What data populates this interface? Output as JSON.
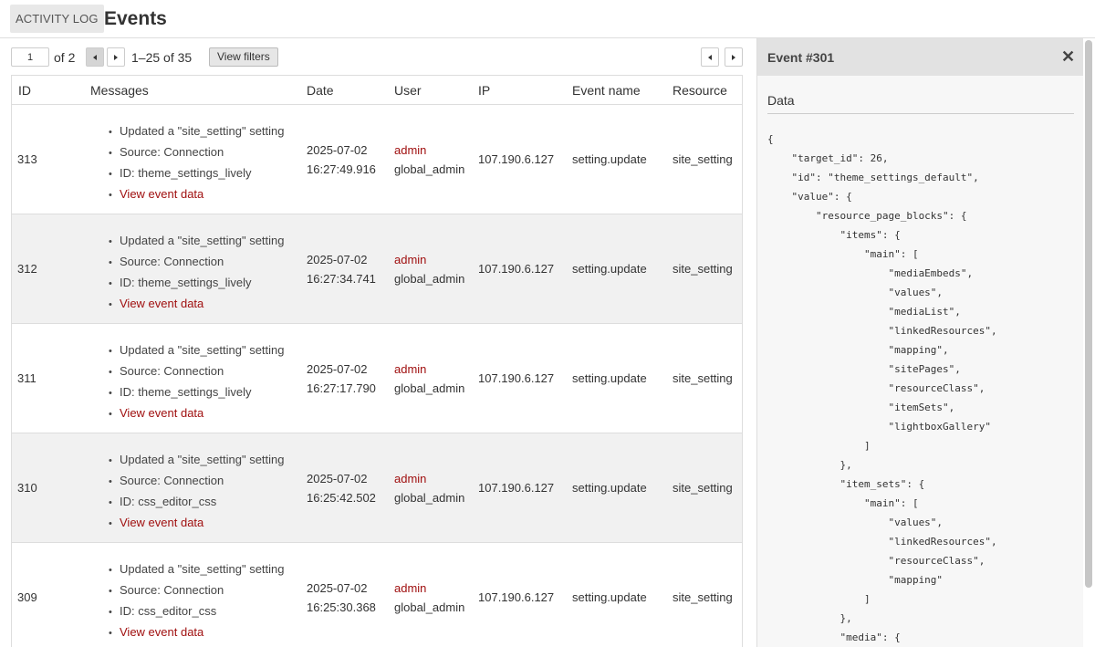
{
  "header": {
    "crumb": "ACTIVITY LOG",
    "title": "Events"
  },
  "pager": {
    "page": "1",
    "of_label": "of 2",
    "range": "1–25 of 35",
    "view_filters": "View filters"
  },
  "table": {
    "columns": [
      "ID",
      "Messages",
      "Date",
      "User",
      "IP",
      "Event name",
      "Resource"
    ],
    "rows": [
      {
        "id": "313",
        "messages": [
          "Updated a \"site_setting\" setting",
          "Source: Connection",
          "ID: theme_settings_lively"
        ],
        "link": "View event data",
        "date": "2025-07-02",
        "time": "16:27:49.916",
        "user": "admin",
        "role": "global_admin",
        "ip": "107.190.6.127",
        "event": "setting.update",
        "resource": "site_setting"
      },
      {
        "id": "312",
        "messages": [
          "Updated a \"site_setting\" setting",
          "Source: Connection",
          "ID: theme_settings_lively"
        ],
        "link": "View event data",
        "date": "2025-07-02",
        "time": "16:27:34.741",
        "user": "admin",
        "role": "global_admin",
        "ip": "107.190.6.127",
        "event": "setting.update",
        "resource": "site_setting"
      },
      {
        "id": "311",
        "messages": [
          "Updated a \"site_setting\" setting",
          "Source: Connection",
          "ID: theme_settings_lively"
        ],
        "link": "View event data",
        "date": "2025-07-02",
        "time": "16:27:17.790",
        "user": "admin",
        "role": "global_admin",
        "ip": "107.190.6.127",
        "event": "setting.update",
        "resource": "site_setting"
      },
      {
        "id": "310",
        "messages": [
          "Updated a \"site_setting\" setting",
          "Source: Connection",
          "ID: css_editor_css"
        ],
        "link": "View event data",
        "date": "2025-07-02",
        "time": "16:25:42.502",
        "user": "admin",
        "role": "global_admin",
        "ip": "107.190.6.127",
        "event": "setting.update",
        "resource": "site_setting"
      },
      {
        "id": "309",
        "messages": [
          "Updated a \"site_setting\" setting",
          "Source: Connection",
          "ID: css_editor_css"
        ],
        "link": "View event data",
        "date": "2025-07-02",
        "time": "16:25:30.368",
        "user": "admin",
        "role": "global_admin",
        "ip": "107.190.6.127",
        "event": "setting.update",
        "resource": "site_setting"
      }
    ]
  },
  "sidebar": {
    "title": "Event #301",
    "close": "✕",
    "section": "Data",
    "json_lines": [
      "{",
      "    \"target_id\": 26,",
      "    \"id\": \"theme_settings_default\",",
      "    \"value\": {",
      "        \"resource_page_blocks\": {",
      "            \"items\": {",
      "                \"main\": [",
      "                    \"mediaEmbeds\",",
      "                    \"values\",",
      "                    \"mediaList\",",
      "                    \"linkedResources\",",
      "                    \"mapping\",",
      "                    \"sitePages\",",
      "                    \"resourceClass\",",
      "                    \"itemSets\",",
      "                    \"lightboxGallery\"",
      "                ]",
      "            },",
      "            \"item_sets\": {",
      "                \"main\": [",
      "                    \"values\",",
      "                    \"linkedResources\",",
      "                    \"resourceClass\",",
      "                    \"mapping\"",
      "                ]",
      "            },",
      "            \"media\": {"
    ]
  },
  "icons": {
    "prev": "chevron-left-icon",
    "next": "chevron-right-icon",
    "close": "close-icon"
  }
}
